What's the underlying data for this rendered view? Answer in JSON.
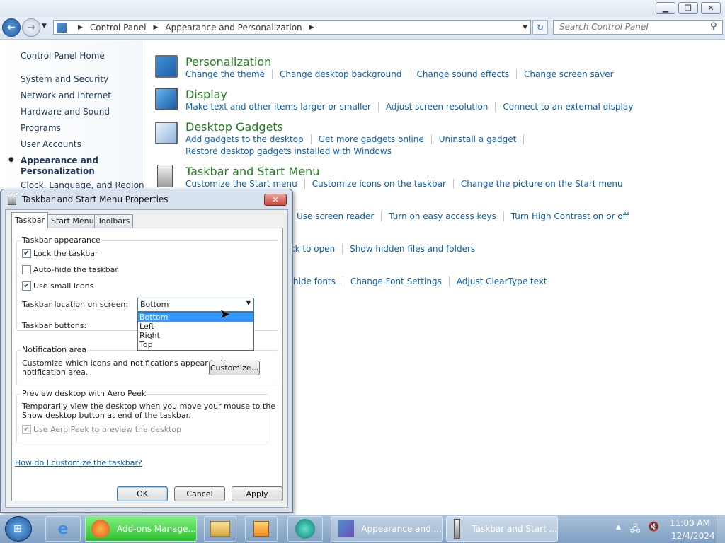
{
  "window": {
    "min_icon": "minimize-icon",
    "max_icon": "maximize-icon",
    "close_icon": "close-icon",
    "breadcrumb": [
      "Control Panel",
      "Appearance and Personalization"
    ],
    "search_placeholder": "Search Control Panel"
  },
  "sidebar": {
    "home": "Control Panel Home",
    "items": [
      "System and Security",
      "Network and Internet",
      "Hardware and Sound",
      "Programs",
      "User Accounts"
    ],
    "active_line1": "Appearance and",
    "active_line2": "Personalization",
    "partial": "Clock, Language, and Region"
  },
  "categories": {
    "personalization": {
      "title": "Personalization",
      "links": [
        "Change the theme",
        "Change desktop background",
        "Change sound effects",
        "Change screen saver"
      ]
    },
    "display": {
      "title": "Display",
      "links": [
        "Make text and other items larger or smaller",
        "Adjust screen resolution",
        "Connect to an external display"
      ]
    },
    "gadgets": {
      "title": "Desktop Gadgets",
      "links": [
        "Add gadgets to the desktop",
        "Get more gadgets online",
        "Uninstall a gadget",
        "Restore desktop gadgets installed with Windows"
      ]
    },
    "taskbar": {
      "title": "Taskbar and Start Menu",
      "links": [
        "Customize the Start menu",
        "Customize icons on the taskbar",
        "Change the picture on the Start menu"
      ]
    },
    "ease": {
      "links": [
        "Use screen reader",
        "Turn on easy access keys",
        "Turn High Contrast on or off"
      ]
    },
    "folder": {
      "links": [
        "ck to open",
        "Show hidden files and folders"
      ]
    },
    "fonts": {
      "links": [
        "hide fonts",
        "Change Font Settings",
        "Adjust ClearType text"
      ]
    }
  },
  "dialog": {
    "title": "Taskbar and Start Menu Properties",
    "tabs": [
      "Taskbar",
      "Start Menu",
      "Toolbars"
    ],
    "appearance_group": "Taskbar appearance",
    "lock": "Lock the taskbar",
    "autohide": "Auto-hide the taskbar",
    "small_icons": "Use small icons",
    "location_label": "Taskbar location on screen:",
    "location_value": "Bottom",
    "location_options": [
      "Bottom",
      "Left",
      "Right",
      "Top"
    ],
    "buttons_label": "Taskbar buttons:",
    "notif_group": "Notification area",
    "notif_text1": "Customize which icons and notifications appear in the",
    "notif_text2": "notification area.",
    "customize": "Customize...",
    "peek_group": "Preview desktop with Aero Peek",
    "peek_text1": "Temporarily view the desktop when you move your mouse to the",
    "peek_text2": "Show desktop button at end of the taskbar.",
    "peek_check": "Use Aero Peek to preview the desktop",
    "help_link": "How do I customize the taskbar?",
    "ok": "OK",
    "cancel": "Cancel",
    "apply": "Apply"
  },
  "taskbar": {
    "firefox": "Add-ons Manage...",
    "explorer": "Appearance and ...",
    "dialog": "Taskbar and Start ...",
    "time": "11:00 AM",
    "date": "12/4/2024"
  },
  "colors": {
    "accent": "#0b5fb0",
    "category_green": "#1f7f1f",
    "selection": "#3399ff"
  }
}
